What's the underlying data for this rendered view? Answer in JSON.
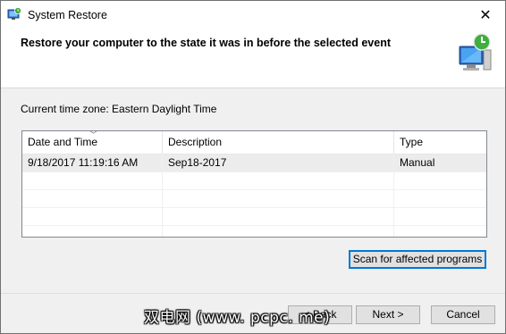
{
  "window": {
    "title": "System Restore",
    "close_glyph": "✕"
  },
  "header": {
    "title": "Restore your computer to the state it was in before the selected event"
  },
  "timezone": "Current time zone: Eastern Daylight Time",
  "table": {
    "columns": [
      "Date and Time",
      "Description",
      "Type"
    ],
    "rows": [
      {
        "date": "9/18/2017 11:19:16 AM",
        "description": "Sep18-2017",
        "type": "Manual"
      }
    ]
  },
  "buttons": {
    "scan": "Scan for affected programs",
    "back": "< Back",
    "next": "Next >",
    "cancel": "Cancel"
  },
  "watermark": "双电网 (www. pcpc. me)",
  "colors": {
    "accent": "#0078d7",
    "border": "#828790"
  },
  "icons": [
    "system-restore-icon",
    "restore-computer-icon",
    "close-icon",
    "sort-desc-icon"
  ]
}
